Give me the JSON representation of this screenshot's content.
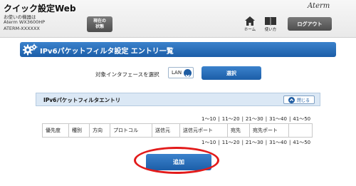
{
  "header": {
    "app_title": "クイック設定Web",
    "device_lines": [
      "お使いの機器は",
      "Aterm WX3600HP",
      "ATERM-XXXXXX"
    ],
    "status_button": [
      "現在の",
      "状態"
    ],
    "brand": "Aterm",
    "nav": {
      "home_label": "ホーム",
      "help_label": "使い方",
      "logout_label": "ログアウト"
    }
  },
  "page": {
    "title": "IPv6パケットフィルタ設定 エントリ一覧"
  },
  "interface_select": {
    "label": "対象インタフェースを選択",
    "selected": "LAN",
    "select_button": "選択"
  },
  "entry_panel": {
    "title": "IPv6パケットフィルタエントリ",
    "collapse_label": "閉じる"
  },
  "pagination": [
    "1～10",
    "11～20",
    "21～30",
    "31～40",
    "41～50"
  ],
  "table": {
    "columns": [
      "優先度",
      "種別",
      "方向",
      "プロトコル",
      "送信元",
      "送信元ポート",
      "宛先",
      "宛先ポート",
      ""
    ]
  },
  "actions": {
    "add_button": "追加"
  },
  "colors": {
    "primary_blue": "#1c5ea8",
    "highlight_red": "#e21b1b",
    "panel_bg": "#dbe8f5"
  }
}
